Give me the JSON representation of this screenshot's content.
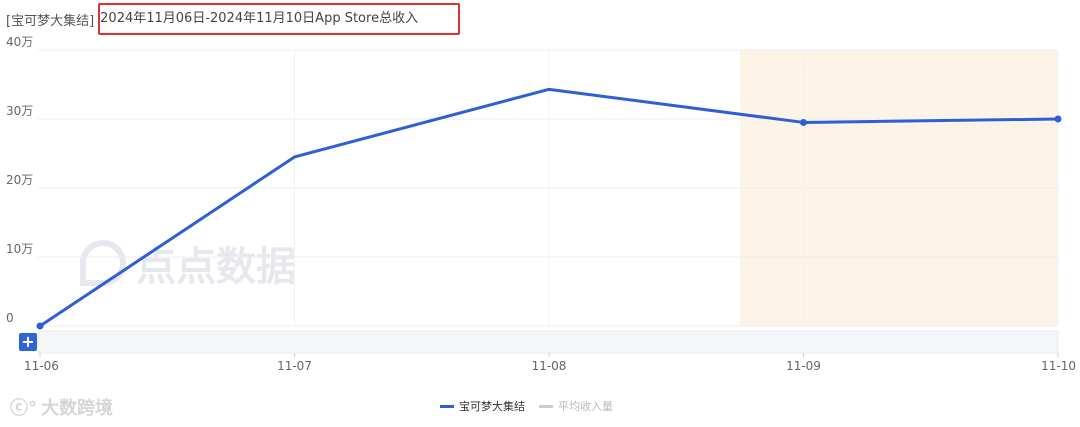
{
  "header": {
    "app_tag": "[宝可梦大集结]",
    "title": "2024年11月06日-2024年11月10日App Store总收入"
  },
  "watermarks": {
    "center": "点点数据",
    "brand": "大数跨境"
  },
  "zoom_button": "+",
  "colors": {
    "line": "#2f5fd6",
    "highlight_band": "#fdf3e6",
    "grid": "#eeeeee",
    "muted_legend": "#cccccc"
  },
  "chart_data": {
    "type": "line",
    "title": "2024年11月06日-2024年11月10日App Store总收入",
    "categories": [
      "11-06",
      "11-07",
      "11-08",
      "11-09",
      "11-10"
    ],
    "series": [
      {
        "name": "宝可梦大集结",
        "values": [
          0,
          245000,
          343000,
          295000,
          300000
        ],
        "color": "#2f5fd6"
      },
      {
        "name": "平均收入量",
        "values": [],
        "color": "#cccccc",
        "hidden": true
      }
    ],
    "y_ticks": [
      {
        "value": 0,
        "label": "0"
      },
      {
        "value": 100000,
        "label": "10万"
      },
      {
        "value": 200000,
        "label": "20万"
      },
      {
        "value": 300000,
        "label": "30万"
      },
      {
        "value": 400000,
        "label": "40万"
      }
    ],
    "ylim": [
      0,
      400000
    ],
    "highlight_range": [
      "11-09",
      "11-10"
    ],
    "grid": true,
    "legend_position": "bottom"
  }
}
